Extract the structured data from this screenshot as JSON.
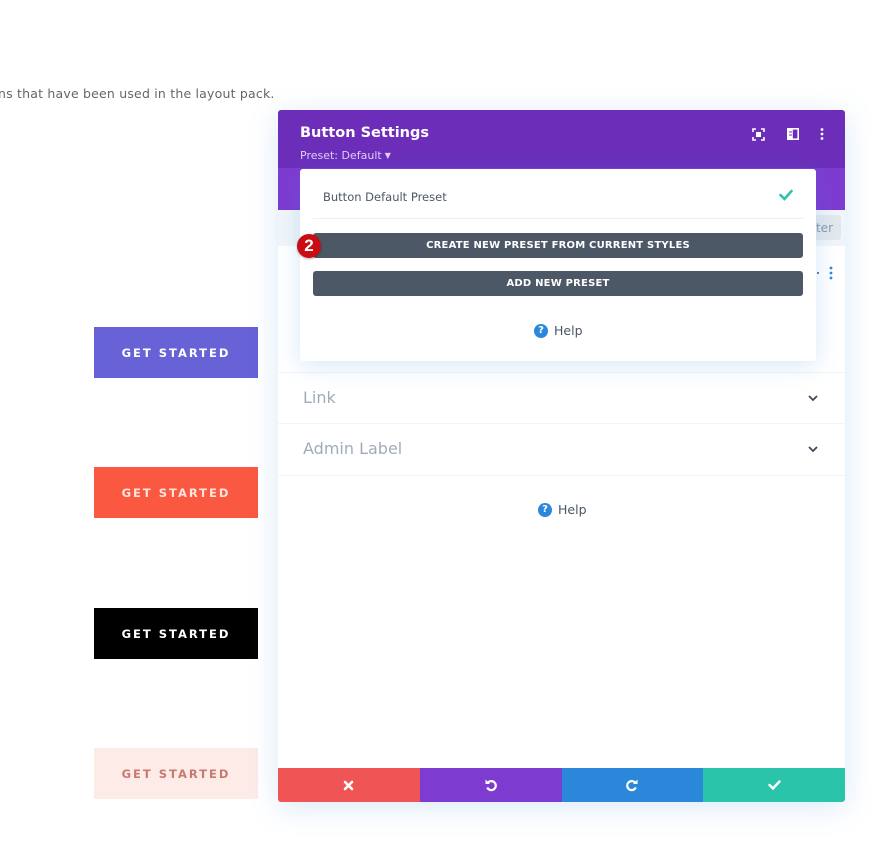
{
  "page": {
    "intro_text": "ns that have been used in the layout pack."
  },
  "demo_buttons": [
    {
      "label": "GET STARTED",
      "bg": "#6762d6",
      "fg": "#ffffff"
    },
    {
      "label": "GET STARTED",
      "bg": "#fa5841",
      "fg": "#fde4dc"
    },
    {
      "label": "GET STARTED",
      "bg": "#000000",
      "fg": "#ffffff"
    },
    {
      "label": "GET STARTED",
      "bg": "#fdebe8",
      "fg": "#c77b6f"
    }
  ],
  "modal": {
    "title": "Button Settings",
    "preset_label": "Preset: Default",
    "header_bg": "#6c2eb9",
    "tab_strip_bg": "#7e3bd0",
    "header_icons": [
      "focus-mode-icon",
      "split-view-icon",
      "more-options-icon"
    ],
    "filter_label": "Filter",
    "sections": [
      {
        "label": "Link"
      },
      {
        "label": "Admin Label"
      }
    ],
    "help_label": "Help",
    "footer": {
      "discard_color": "#ef5555",
      "undo_color": "#7e3bd0",
      "redo_color": "#2b87da",
      "save_color": "#29c4a9"
    }
  },
  "preset_dropdown": {
    "items": [
      {
        "label": "Button Default Preset",
        "selected": true
      }
    ],
    "actions": [
      {
        "label": "CREATE NEW PRESET FROM CURRENT STYLES"
      },
      {
        "label": "ADD NEW PRESET"
      }
    ],
    "help_label": "Help",
    "check_color": "#29c4a9"
  },
  "annotation": {
    "step_number": "2"
  }
}
